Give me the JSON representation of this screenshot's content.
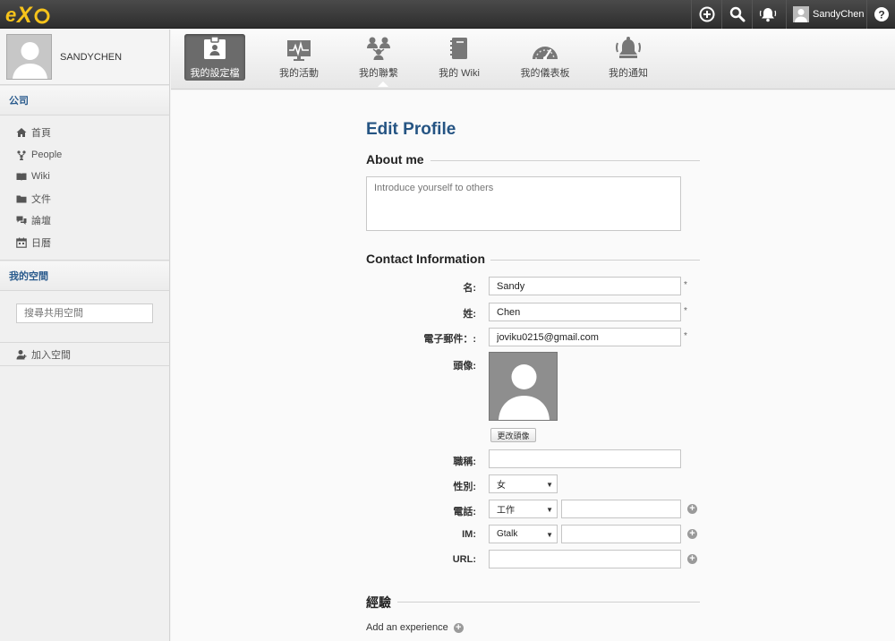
{
  "topbar": {
    "brand": "eXo",
    "user_name": "SandyChen",
    "icons": [
      "add-icon",
      "search-icon",
      "notification-bell-icon",
      "help-icon"
    ]
  },
  "sidebar": {
    "profile_name": "SANDYCHEN",
    "company_heading": "公司",
    "company_items": [
      {
        "label": "首頁",
        "icon": "home-icon"
      },
      {
        "label": "People",
        "icon": "people-icon"
      },
      {
        "label": "Wiki",
        "icon": "wiki-icon"
      },
      {
        "label": "文件",
        "icon": "folder-icon"
      },
      {
        "label": "論壇",
        "icon": "forum-icon"
      },
      {
        "label": "日曆",
        "icon": "calendar-icon"
      }
    ],
    "my_spaces_heading": "我的空間",
    "space_search_placeholder": "搜尋共用空間",
    "join_space_label": "加入空間"
  },
  "tabs": [
    {
      "label": "我的設定檔",
      "icon": "profile-card-icon",
      "active": true
    },
    {
      "label": "我的活動",
      "icon": "activity-chart-icon",
      "active": false
    },
    {
      "label": "我的聯繫",
      "icon": "connections-icon",
      "active": false
    },
    {
      "label": "我的 Wiki",
      "icon": "wiki-book-icon",
      "active": false
    },
    {
      "label": "我的儀表板",
      "icon": "dashboard-gauge-icon",
      "active": false
    },
    {
      "label": "我的通知",
      "icon": "notification-bell-icon",
      "active": false
    }
  ],
  "form": {
    "title": "Edit Profile",
    "about_heading": "About me",
    "about_placeholder": "Introduce yourself to others",
    "contact_heading": "Contact Information",
    "first_name_label": "名:",
    "first_name_value": "Sandy",
    "last_name_label": "姓:",
    "last_name_value": "Chen",
    "email_label": "電子郵件：:",
    "email_value": "joviku0215@gmail.com",
    "required_mark": "*",
    "avatar_label": "頭像:",
    "change_avatar_button": "更改頭像",
    "position_label": "職稱:",
    "position_value": "",
    "gender_label": "性別:",
    "gender_value": "女",
    "phone_label": "電話:",
    "phone_type": "工作",
    "phone_value": "",
    "im_label": "IM:",
    "im_type": "Gtalk",
    "im_value": "",
    "url_label": "URL:",
    "url_value": "",
    "experience_heading": "經驗",
    "add_experience_label": "Add an experience"
  }
}
